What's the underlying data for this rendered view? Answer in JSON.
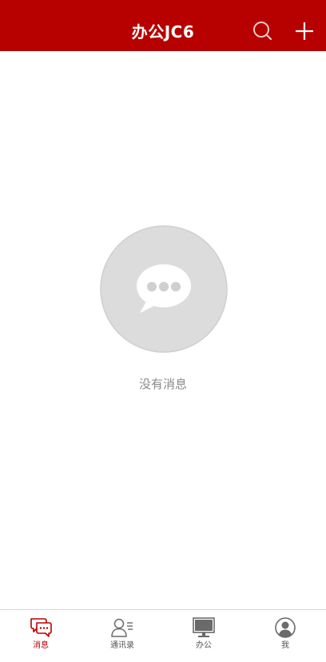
{
  "header": {
    "title": "办公JC6",
    "background_color": "#b70000",
    "search_icon": "search-icon",
    "add_icon": "plus-icon"
  },
  "empty_state": {
    "icon": "chat-bubble-icon",
    "message": "没有消息"
  },
  "tabbar": {
    "active_color": "#b70000",
    "items": [
      {
        "label": "消息",
        "icon": "chat-bubbles-icon",
        "active": true
      },
      {
        "label": "通讯录",
        "icon": "contacts-icon",
        "active": false
      },
      {
        "label": "办公",
        "icon": "monitor-icon",
        "active": false
      },
      {
        "label": "我",
        "icon": "user-circle-icon",
        "active": false
      }
    ]
  }
}
